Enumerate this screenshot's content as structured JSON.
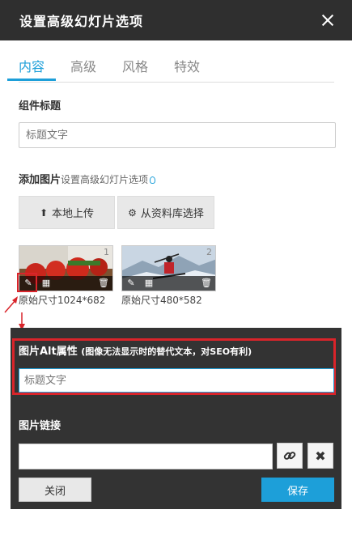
{
  "dialog": {
    "title": "设置高级幻灯片选项",
    "tabs": [
      "内容",
      "高级",
      "风格",
      "特效"
    ],
    "widget_title_label": "组件标题",
    "widget_title_placeholder": "标题文字",
    "add_image_label": "添加图片",
    "add_image_hint": "设置高级幻灯片选项",
    "upload_local": "本地上传",
    "from_library": "从资料库选择",
    "images": [
      {
        "num": "1",
        "size": "原始尺寸1024*682"
      },
      {
        "num": "2",
        "size": "原始尺寸480*582"
      }
    ],
    "alt_label": "图片Alt属性",
    "alt_hint": "(图像无法显示时的替代文本，对SEO有利)",
    "alt_placeholder": "标题文字",
    "link_label": "图片链接",
    "close_button": "关闭",
    "save_button": "保存"
  },
  "icons": [
    "close-icon",
    "upload-icon",
    "gear-icon",
    "edit-icon",
    "grid-icon",
    "trash-icon",
    "link-icon",
    "remove-icon",
    "lightbulb-icon"
  ],
  "colors": {
    "accent": "#1d9fd9",
    "highlight": "#d9242a",
    "titlebar": "#2f2f2f"
  }
}
